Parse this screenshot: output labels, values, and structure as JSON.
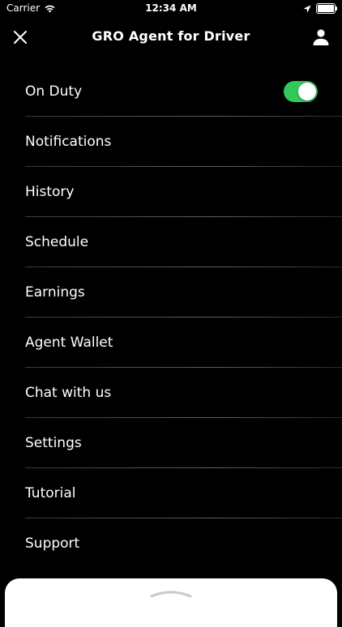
{
  "status_bar": {
    "carrier": "Carrier",
    "time": "12:34 AM"
  },
  "header": {
    "title": "GRO Agent for Driver"
  },
  "menu": {
    "on_duty": {
      "label": "On Duty",
      "enabled": true
    },
    "items": [
      {
        "label": "Notifications"
      },
      {
        "label": "History"
      },
      {
        "label": "Schedule"
      },
      {
        "label": "Earnings"
      },
      {
        "label": "Agent Wallet"
      },
      {
        "label": "Chat with us"
      },
      {
        "label": "Settings"
      },
      {
        "label": "Tutorial"
      },
      {
        "label": "Support"
      }
    ]
  },
  "colors": {
    "background": "#000000",
    "text": "#ffffff",
    "toggle_on": "#34c759",
    "divider": "#4a4a4a",
    "sheet": "#ffffff"
  },
  "icons": {
    "close": "close-icon",
    "profile": "person-icon",
    "wifi": "wifi-icon",
    "location": "location-arrow-icon",
    "battery": "battery-icon",
    "sheet_handle": "chevron-up-icon"
  }
}
